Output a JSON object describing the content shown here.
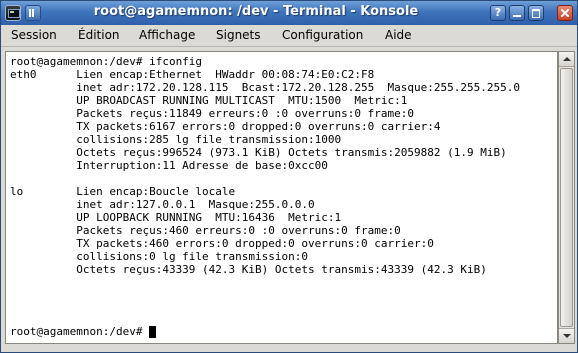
{
  "window": {
    "title": "root@agamemnon: /dev - Terminal - Konsole"
  },
  "titlebar_buttons": {
    "help": "?"
  },
  "menu": {
    "items": [
      "Session",
      "Édition",
      "Affichage",
      "Signets",
      "Configuration",
      "Aide"
    ]
  },
  "terminal": {
    "lines": [
      "root@agamemnon:/dev# ifconfig",
      "eth0      Lien encap:Ethernet  HWaddr 00:08:74:E0:C2:F8",
      "          inet adr:172.20.128.115  Bcast:172.20.128.255  Masque:255.255.255.0",
      "          UP BROADCAST RUNNING MULTICAST  MTU:1500  Metric:1",
      "          Packets reçus:11849 erreurs:0 :0 overruns:0 frame:0",
      "          TX packets:6167 errors:0 dropped:0 overruns:0 carrier:4",
      "          collisions:285 lg file transmission:1000",
      "          Octets reçus:996524 (973.1 KiB) Octets transmis:2059882 (1.9 MiB)",
      "          Interruption:11 Adresse de base:0xcc00",
      "",
      "lo        Lien encap:Boucle locale",
      "          inet adr:127.0.0.1  Masque:255.0.0.0",
      "          UP LOOPBACK RUNNING  MTU:16436  Metric:1",
      "          Packets reçus:460 erreurs:0 :0 overruns:0 frame:0",
      "          TX packets:460 errors:0 dropped:0 overruns:0 carrier:0",
      "          collisions:0 lg file transmission:0",
      "          Octets reçus:43339 (42.3 KiB) Octets transmis:43339 (42.3 KiB)",
      ""
    ],
    "prompt": "root@agamemnon:/dev# "
  }
}
